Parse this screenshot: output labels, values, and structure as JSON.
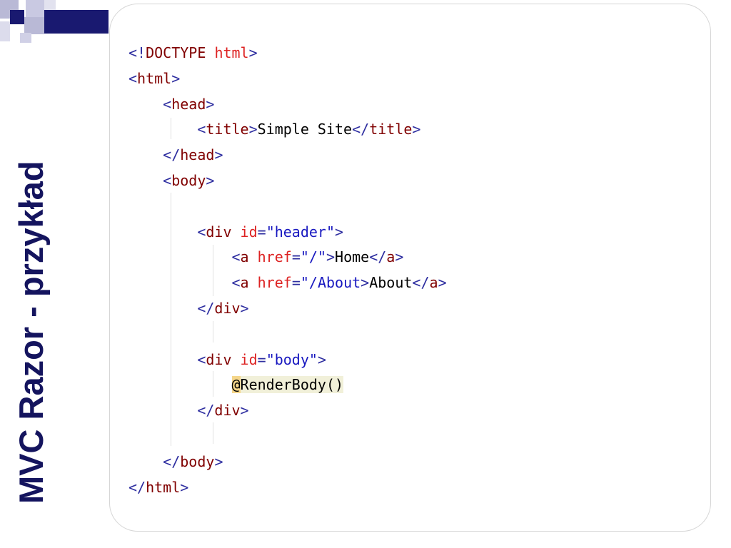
{
  "slide": {
    "title": "MVC Razor - przykład"
  },
  "colors": {
    "title": "#14145e",
    "logo_dark": "#191970",
    "logo_light": "#b9b9d6",
    "code_bracket": "#2e2ea0",
    "code_tag": "#8b0000",
    "code_attr": "#dd2222",
    "code_value": "#1818c0"
  },
  "code": {
    "l1": {
      "open": "<!",
      "name": "DOCTYPE",
      "sp": " ",
      "word": "html",
      "close": ">"
    },
    "l2": {
      "open": "<",
      "name": "html",
      "close": ">"
    },
    "l3": {
      "open": "<",
      "name": "head",
      "close": ">"
    },
    "l4": {
      "open": "<",
      "name": "title",
      "close": ">",
      "text": "Simple Site",
      "open2": "</",
      "name2": "title",
      "close2": ">"
    },
    "l5": {
      "open": "</",
      "name": "head",
      "close": ">"
    },
    "l6": {
      "open": "<",
      "name": "body",
      "close": ">"
    },
    "l8": {
      "open": "<",
      "name": "div",
      "attr": "id",
      "eq": "=",
      "val": "\"header\"",
      "close": ">"
    },
    "l9": {
      "open": "<",
      "name": "a",
      "attr": "href",
      "eq": "=",
      "val": "\"/\"",
      "close": ">",
      "text": "Home",
      "open2": "</",
      "name2": "a",
      "close2": ">"
    },
    "l10": {
      "open": "<",
      "name": "a",
      "attr": "href",
      "eq": "=",
      "val": "\"/About",
      "close": ">",
      "text": "About",
      "open2": "</",
      "name2": "a",
      "close2": ">"
    },
    "l11": {
      "open": "</",
      "name": "div",
      "close": ">"
    },
    "l13": {
      "open": "<",
      "name": "div",
      "attr": "id",
      "eq": "=",
      "val": "\"body\"",
      "close": ">"
    },
    "l14": {
      "at": "@",
      "call": "RenderBody()"
    },
    "l15": {
      "open": "</",
      "name": "div",
      "close": ">"
    },
    "l17": {
      "open": "</",
      "name": "body",
      "close": ">"
    },
    "l18": {
      "open": "</",
      "name": "html",
      "close": ">"
    }
  }
}
